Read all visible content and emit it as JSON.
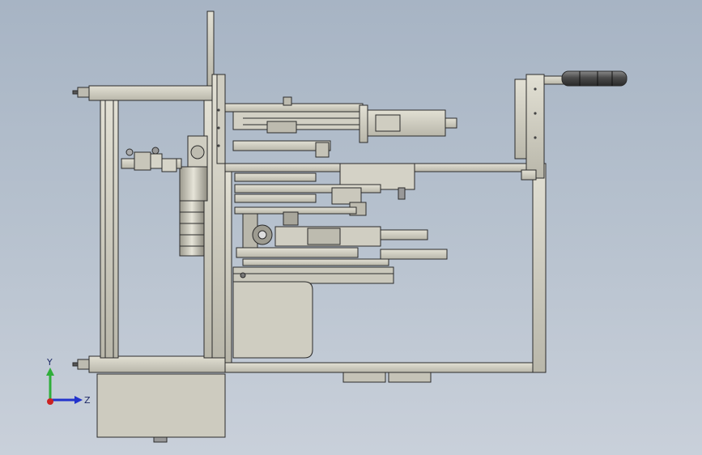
{
  "viewport": {
    "background_top": "#a7b4c4",
    "background_bottom": "#c9d0da",
    "model_line_color": "#2b2b2b",
    "model_fill_light": "#d8d6c8",
    "model_fill_dark": "#a9a79a"
  },
  "triad": {
    "y_label": "Y",
    "z_label": "Z",
    "y_color": "#2fae3a",
    "z_color": "#2233cc",
    "x_color": "#cc2222"
  }
}
